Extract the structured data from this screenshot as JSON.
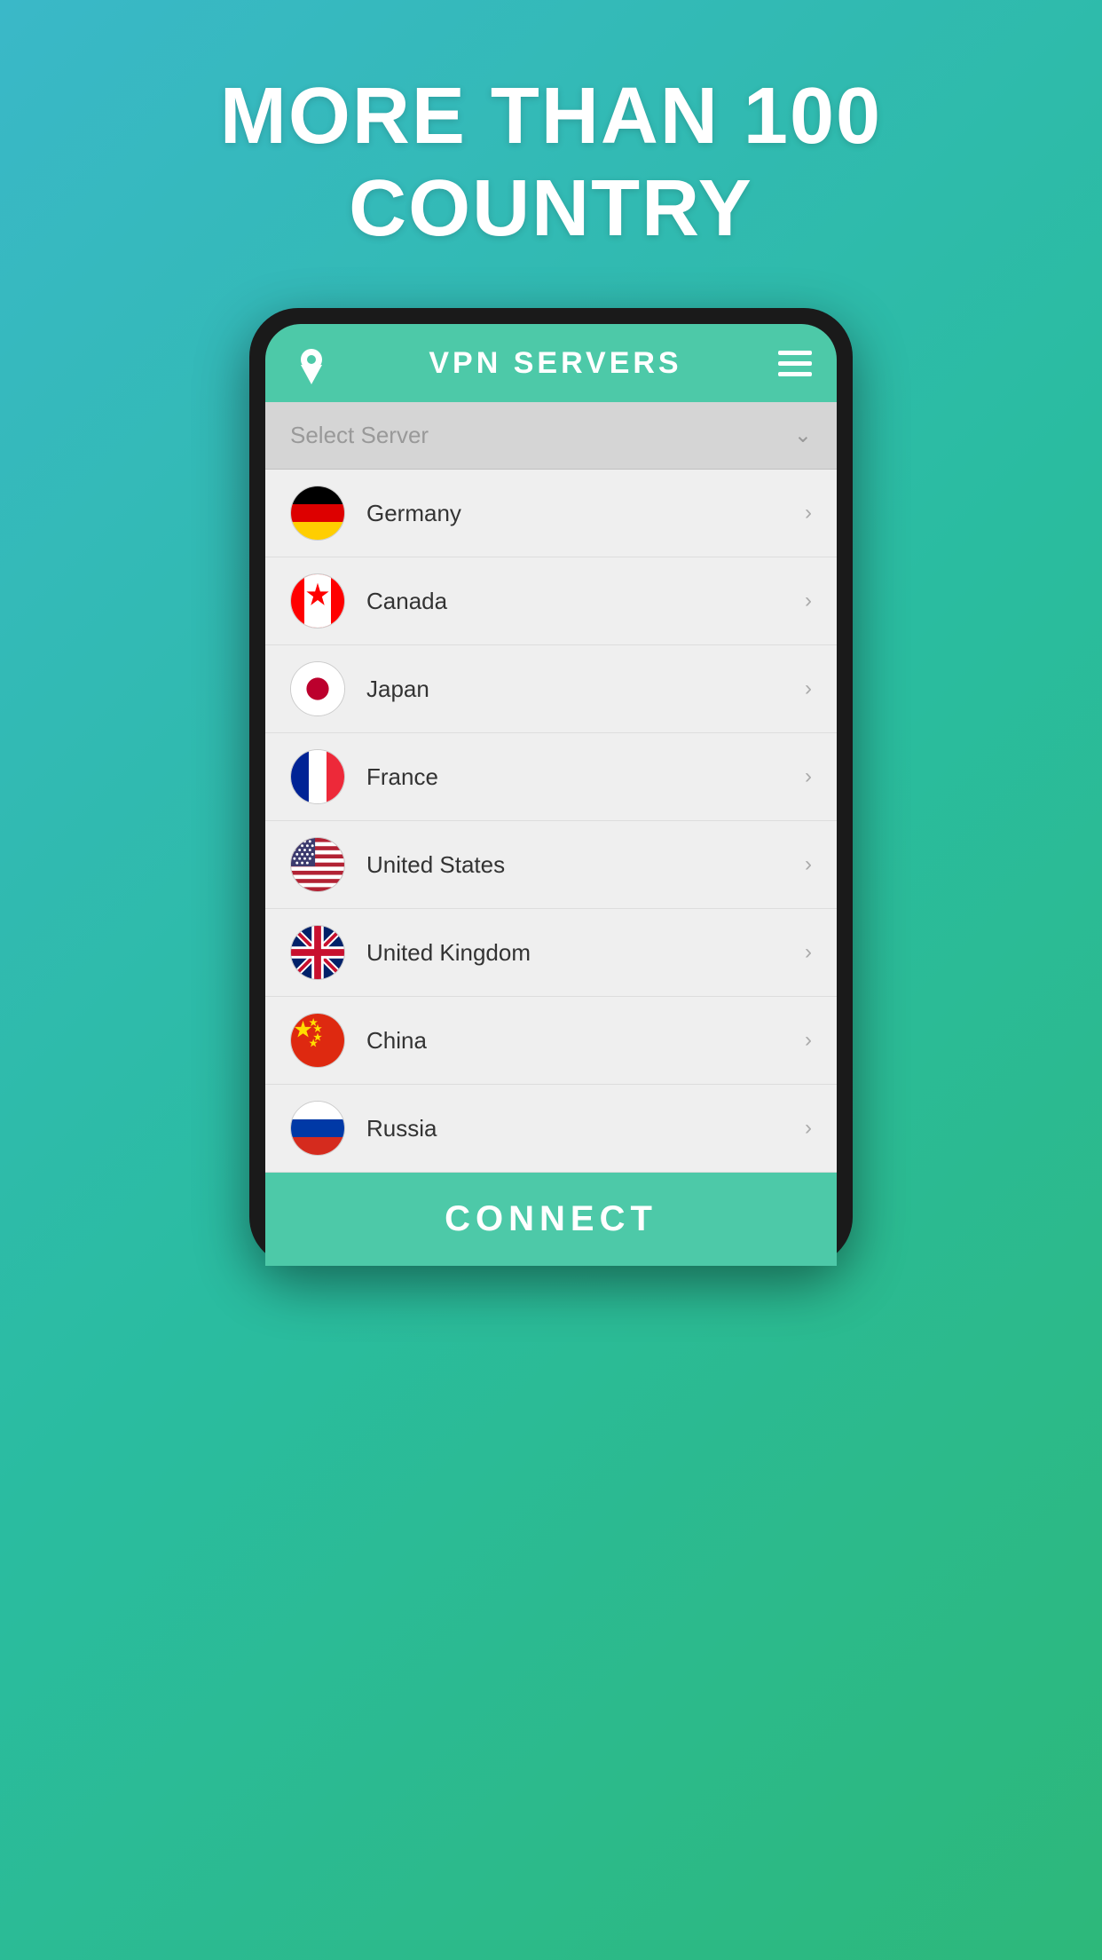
{
  "background": {
    "gradient_start": "#3ab8c8",
    "gradient_end": "#2db87a"
  },
  "headline": {
    "line1": "MORE THAN 100",
    "line2": "COUNTRY"
  },
  "app": {
    "header": {
      "title": "VPN SERVERS",
      "logo_alt": "vpn-logo"
    },
    "select_server_placeholder": "Select Server",
    "countries": [
      {
        "name": "Germany",
        "code": "de"
      },
      {
        "name": "Canada",
        "code": "ca"
      },
      {
        "name": "Japan",
        "code": "jp"
      },
      {
        "name": "France",
        "code": "fr"
      },
      {
        "name": "United States",
        "code": "us"
      },
      {
        "name": "United Kingdom",
        "code": "gb"
      },
      {
        "name": "China",
        "code": "cn"
      },
      {
        "name": "Russia",
        "code": "ru"
      }
    ],
    "connect_button_label": "CONNECT"
  }
}
